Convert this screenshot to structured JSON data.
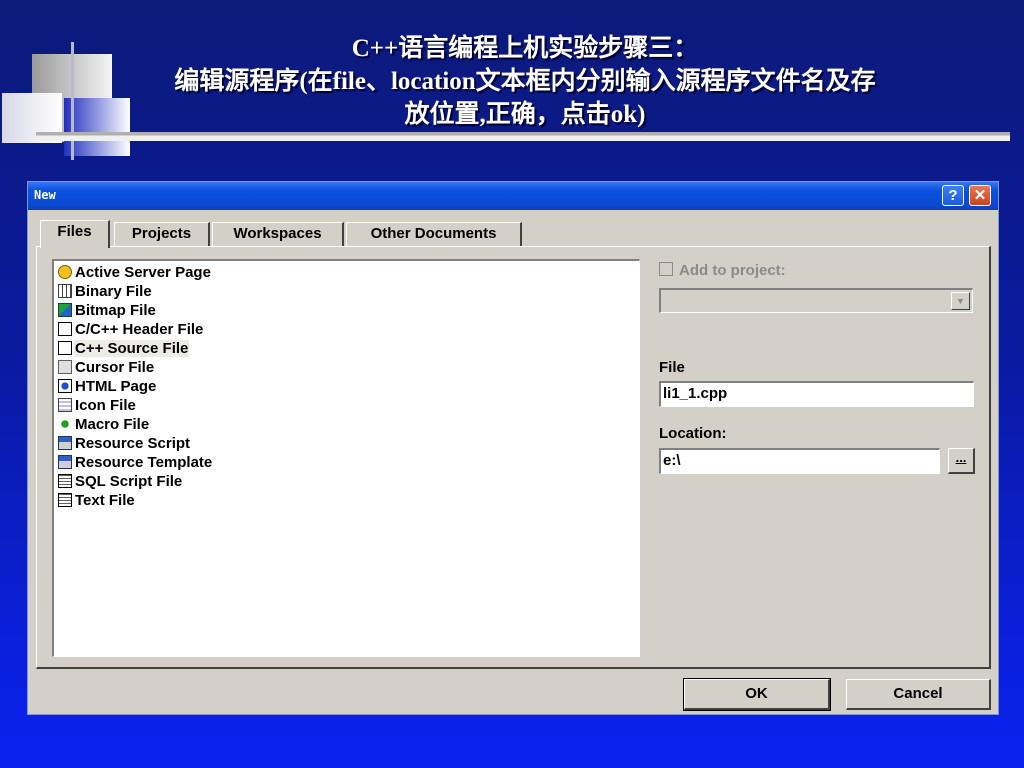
{
  "slide": {
    "title_line1": "C++语言编程上机实验步骤三：",
    "title_line2": "编辑源程序(在file、location文本框内分别输入源程序文件名及存",
    "title_line3": "放位置,正确，点击ok)"
  },
  "dialog": {
    "title": "New",
    "help_glyph": "?",
    "close_glyph": "✕",
    "tabs": [
      "Files",
      "Projects",
      "Workspaces",
      "Other Documents"
    ],
    "active_tab": "Files",
    "file_types": [
      {
        "label": "Active Server Page",
        "icon": "asp-icon"
      },
      {
        "label": "Binary File",
        "icon": "binary-icon"
      },
      {
        "label": "Bitmap File",
        "icon": "bitmap-icon"
      },
      {
        "label": "C/C++ Header File",
        "icon": "header-file-icon"
      },
      {
        "label": "C++ Source File",
        "icon": "source-file-icon"
      },
      {
        "label": "Cursor File",
        "icon": "cursor-icon"
      },
      {
        "label": "HTML Page",
        "icon": "html-icon"
      },
      {
        "label": "Icon File",
        "icon": "icon-file-icon"
      },
      {
        "label": "Macro File",
        "icon": "macro-icon"
      },
      {
        "label": "Resource Script",
        "icon": "resource-script-icon"
      },
      {
        "label": "Resource Template",
        "icon": "resource-template-icon"
      },
      {
        "label": "SQL Script File",
        "icon": "sql-file-icon"
      },
      {
        "label": "Text File",
        "icon": "text-file-icon"
      }
    ],
    "selected_file_type": "C++ Source File",
    "add_to_project_label": "Add to project:",
    "add_to_project_checked": false,
    "file_label": "File",
    "file_value": "li1_1.cpp",
    "location_label": "Location:",
    "location_value": "e:\\",
    "browse_label": "...",
    "ok_label": "OK",
    "cancel_label": "Cancel"
  },
  "colors": {
    "title_bar": "#0a4ad2",
    "dialog_bg": "#d4d0c8",
    "slide_bg": "#0b1fd6",
    "close_button": "#c94420"
  }
}
